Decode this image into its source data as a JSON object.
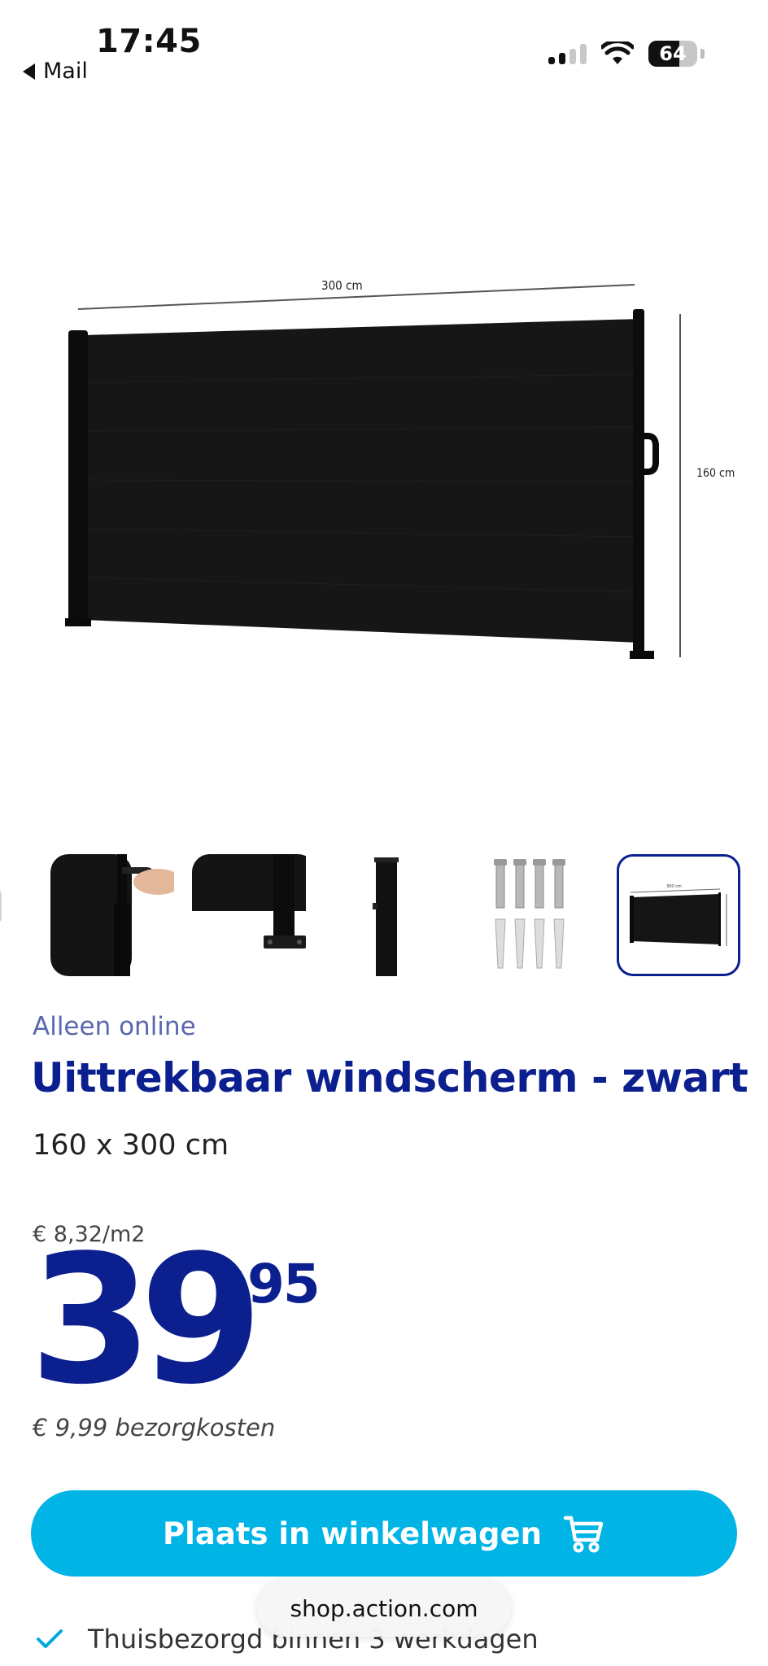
{
  "status_bar": {
    "time": "17:45",
    "back_label": "Mail",
    "battery_percent": 64,
    "battery_label": "64",
    "signal_bars_active": 2,
    "signal_bars_total": 4
  },
  "product_image": {
    "width_label": "300 cm",
    "height_label": "160 cm"
  },
  "thumbnails": {
    "count": 5,
    "active_index": 4,
    "items": [
      {
        "name": "handle-detail"
      },
      {
        "name": "base-plate-detail"
      },
      {
        "name": "pole-detail"
      },
      {
        "name": "mounting-screws"
      },
      {
        "name": "product-overview"
      }
    ]
  },
  "product": {
    "tag": "Alleen online",
    "title": "Uittrekbaar windscherm - zwart",
    "dimensions": "160 x 300 cm",
    "unit_price": "€ 8,32/m2",
    "price_euros": "39",
    "price_cents": "95",
    "delivery_cost": "€ 9,99 bezorgkosten"
  },
  "cart_button": {
    "label": "Plaats in winkelwagen",
    "icon": "cart-icon"
  },
  "usp": {
    "icon": "check-icon",
    "text": "Thuisbezorgd binnen 3 werkdagen"
  },
  "browser": {
    "url": "shop.action.com"
  },
  "colors": {
    "brand_blue": "#0b1f8f",
    "button_cyan": "#00b4e6",
    "tag_blue": "#5a67b0"
  }
}
